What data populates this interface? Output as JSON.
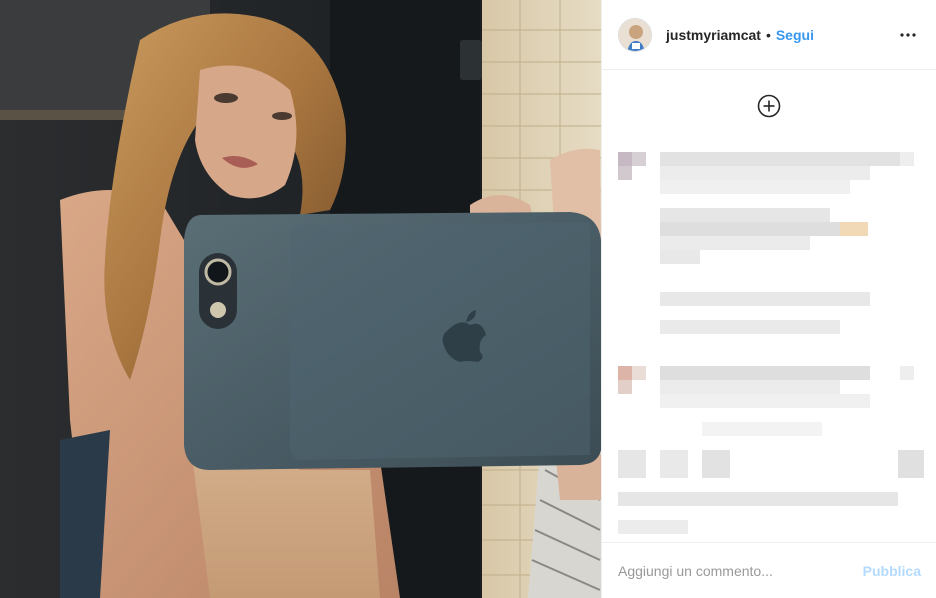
{
  "post": {
    "username": "justmyriamcat",
    "separator": "•",
    "follow_label": "Segui",
    "more_icon": "more-options-icon",
    "add_icon": "plus-circle-icon"
  },
  "comment_box": {
    "placeholder": "Aggiungi un commento...",
    "publish_label": "Pubblica"
  },
  "colors": {
    "link_blue": "#3897f0",
    "publish_disabled": "#b3dbff",
    "border": "#efefef"
  }
}
